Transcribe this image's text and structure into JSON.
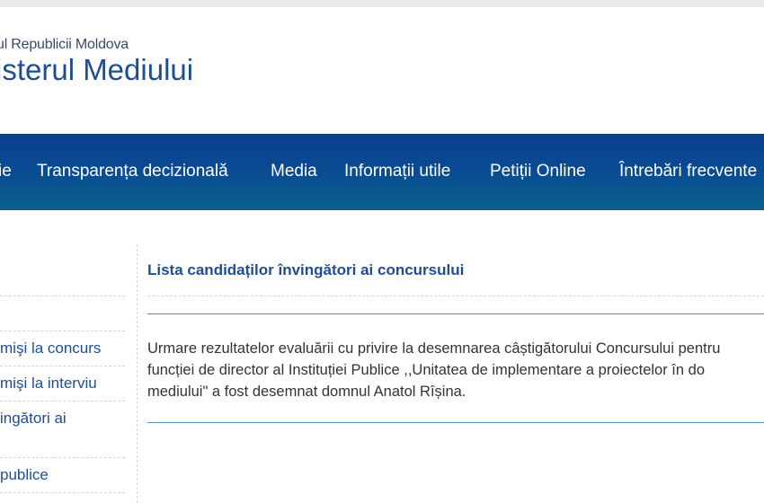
{
  "header": {
    "gov_line": "ul Republicii Moldova",
    "ministry_title": "isterul Mediului"
  },
  "nav": {
    "items": [
      "ie",
      "Transparența decizională",
      "Media",
      "Informații utile",
      "Petiții Online",
      "Întrebări frecvente"
    ]
  },
  "sidebar": {
    "items": [
      "mişi la concurs",
      "mişi la interviu",
      "ingători ai",
      "publice"
    ]
  },
  "content": {
    "title": "Lista candidaților învingători ai concursului",
    "paragraph": " Urmare rezultatelor evaluării cu privire la desemnarea câștigătorului Concursului pentru\nfuncției de director al Instituției Publice ,,Unitatea de implementare a proiectelor în do\nmediului\" a fost desemnat domnul Anatol Rîșina."
  },
  "colors": {
    "brand_blue": "#1f4d94",
    "nav_gradient_top": "#0d3d92",
    "nav_gradient_bottom": "#0a5f8e",
    "rule_blue": "#5b8dbf"
  }
}
